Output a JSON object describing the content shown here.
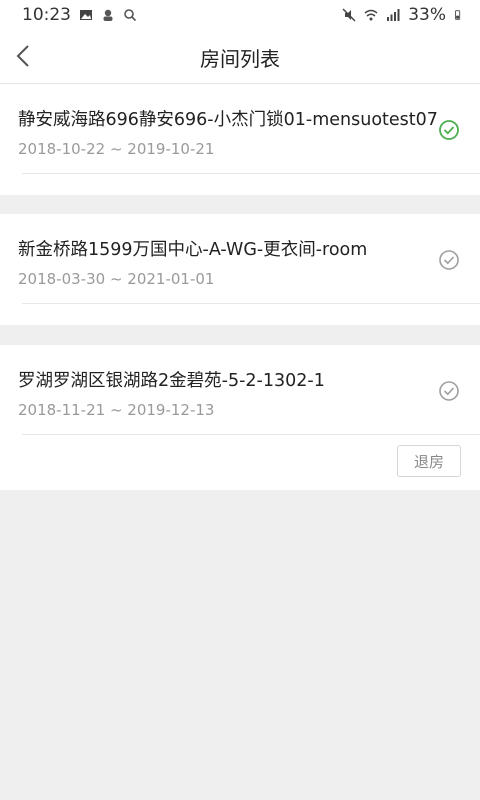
{
  "status_bar": {
    "time": "10:23",
    "battery": "33%",
    "icons_left": [
      "image-icon",
      "app-notification-icon",
      "search-icon"
    ],
    "icons_right": [
      "mute-icon",
      "wifi-icon",
      "signal-icon",
      "battery-icon"
    ]
  },
  "header": {
    "title": "房间列表",
    "back_icon": "chevron-left-icon"
  },
  "rooms": [
    {
      "name": "静安威海路696静安696-小杰门锁01-mensuotest07",
      "dates": "2018-10-22 ~ 2019-10-21",
      "selected": true,
      "check_color": "#4caf50"
    },
    {
      "name": "新金桥路1599万国中心-A-WG-更衣间-room",
      "dates": "2018-03-30 ~ 2021-01-01",
      "selected": false,
      "check_color": "#a0a0a0"
    },
    {
      "name": "罗湖罗湖区银湖路2金碧苑-5-2-1302-1",
      "dates": "2018-11-21 ~ 2019-12-13",
      "selected": false,
      "check_color": "#a0a0a0"
    }
  ],
  "actions": {
    "checkout_label": "退房"
  },
  "colors": {
    "background": "#efefef",
    "card": "#ffffff",
    "accent_green": "#4caf50"
  }
}
